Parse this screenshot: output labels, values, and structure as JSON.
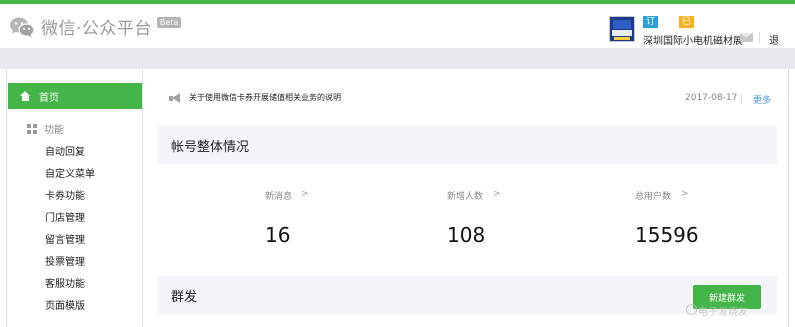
{
  "brand": {
    "title": "微信·公众平台",
    "beta": "Beta",
    "accent_color": "#44b549"
  },
  "account": {
    "badge_subscription": "订阅号",
    "badge_verified": "已认证",
    "name": "深圳国际小电机磁材展",
    "logout": "退出"
  },
  "sidebar": {
    "home": "首页",
    "group_title": "功能",
    "items": [
      "自动回复",
      "自定义菜单",
      "卡券功能",
      "门店管理",
      "留言管理",
      "投票管理",
      "客服功能",
      "页面模版"
    ]
  },
  "notice": {
    "text": "关于使用微信卡券开展储值相关业务的说明",
    "date": "2017-08-17",
    "more": "更多"
  },
  "overview": {
    "title": "帐号整体情况",
    "stats": [
      {
        "label": "新消息",
        "value": "16"
      },
      {
        "label": "新增人数",
        "value": "108"
      },
      {
        "label": "总用户数",
        "value": "15596"
      }
    ]
  },
  "mass": {
    "title": "群发",
    "create_button": "新建群发"
  },
  "watermark": "电子发烧友"
}
